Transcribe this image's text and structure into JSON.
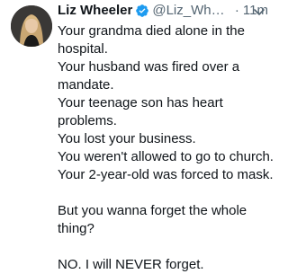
{
  "tweet": {
    "author": {
      "display_name": "Liz Wheeler",
      "handle": "@Liz_Wheel...",
      "verified": true,
      "avatar_icon": "profile-photo"
    },
    "time": "11m",
    "separator": "·",
    "menu_icon": "chevron-down-icon",
    "lines": [
      "Your grandma died alone in the",
      "hospital.",
      "Your husband was fired over a",
      "mandate.",
      "Your teenage son has heart",
      "problems.",
      "You lost your business.",
      "You weren't allowed to go to church.",
      "Your 2-year-old was forced to mask."
    ],
    "question_lines": [
      "But you wanna forget the whole",
      "thing?"
    ],
    "closing_line": "NO. I will NEVER forget."
  },
  "colors": {
    "text_primary": "#0f1419",
    "text_secondary": "#536471",
    "verified_badge": "#1d9bf0",
    "background": "#ffffff"
  }
}
